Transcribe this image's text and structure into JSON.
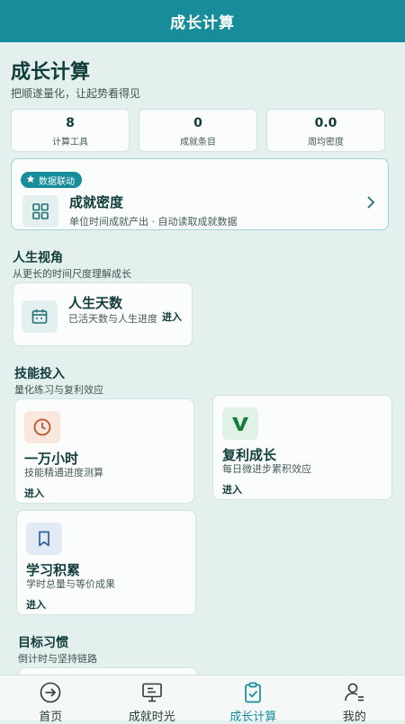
{
  "header": {
    "title": "成长计算"
  },
  "page": {
    "title": "成长计算",
    "subtitle": "把顺遂量化，让起势看得见"
  },
  "stats": [
    {
      "value": "8",
      "label": "计算工具"
    },
    {
      "value": "0",
      "label": "成就条目"
    },
    {
      "value": "0.0",
      "label": "周均密度"
    }
  ],
  "feature": {
    "badge": "数据联动",
    "title": "成就密度",
    "desc": "单位时间成就产出 · 自动读取成就数据",
    "icon": "grid-icon"
  },
  "sections": {
    "life": {
      "title": "人生视角",
      "subtitle": "从更长的时间尺度理解成长"
    },
    "skill": {
      "title": "技能投入",
      "subtitle": "量化练习与复利效应"
    },
    "goal": {
      "title": "目标习惯",
      "subtitle": "倒计时与坚持链路"
    }
  },
  "cards": {
    "life_days": {
      "title": "人生天数",
      "desc": "已活天数与人生进度",
      "enter": "进入",
      "icon": "calendar-icon"
    },
    "ten_thousand": {
      "title": "一万小时",
      "desc": "技能精通进度测算",
      "enter": "进入",
      "icon": "clock-icon"
    },
    "compound": {
      "title": "复利成长",
      "desc": "每日微进步累积效应",
      "enter": "进入",
      "icon": "v-letter-icon"
    },
    "study": {
      "title": "学习积累",
      "desc": "学时总量与等价成果",
      "enter": "进入",
      "icon": "bookmark-icon"
    }
  },
  "tabs": [
    {
      "label": "首页",
      "icon": "arrow-circle-icon"
    },
    {
      "label": "成就时光",
      "icon": "monitor-icon"
    },
    {
      "label": "成长计算",
      "icon": "clipboard-check-icon"
    },
    {
      "label": "我的",
      "icon": "user-icon"
    }
  ],
  "colors": {
    "accent": "#178d9b",
    "background": "#e4f0ee",
    "card": "#fbfdfd",
    "text": "#103c3a"
  }
}
